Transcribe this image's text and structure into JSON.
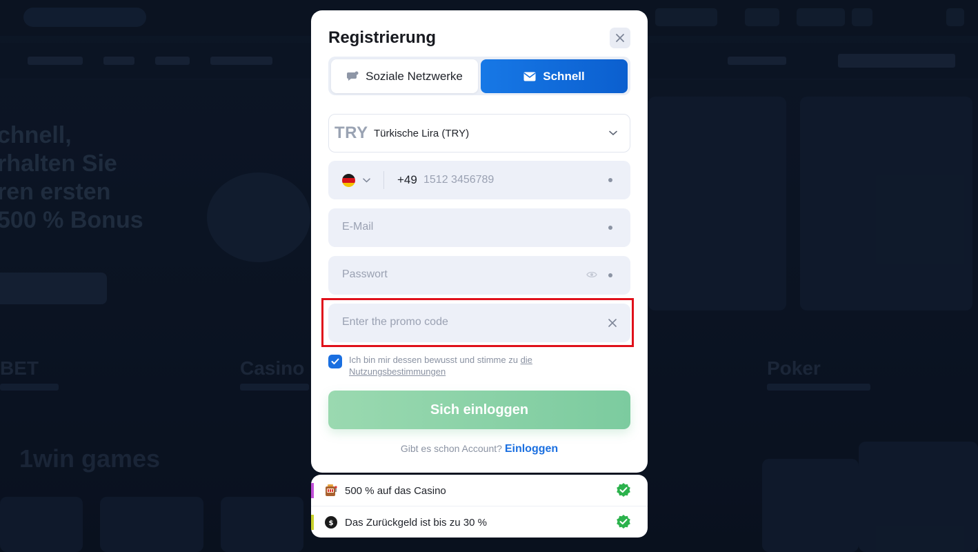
{
  "modal": {
    "title": "Registrierung",
    "tabs": [
      {
        "label": "Soziale Netzwerke",
        "icon": "chat-bubble-icon",
        "active": false
      },
      {
        "label": "Schnell",
        "icon": "envelope-icon",
        "active": true
      }
    ],
    "currency": {
      "code": "TRY",
      "name": "Türkische Lira (TRY)"
    },
    "phone": {
      "country_flag": "de-flag",
      "dial_code": "+49",
      "placeholder": "1512 3456789"
    },
    "email": {
      "placeholder": "E-Mail"
    },
    "password": {
      "placeholder": "Passwort"
    },
    "promo": {
      "placeholder": "Enter the promo code"
    },
    "consent": {
      "checked": true,
      "text": "Ich bin mir dessen bewusst und stimme zu",
      "link": "die Nutzungsbestimmungen"
    },
    "submit_label": "Sich einloggen",
    "login_prompt": "Gibt es schon Account?",
    "login_link": "Einloggen"
  },
  "bonus": [
    {
      "text": "500 % auf das Casino",
      "icon": "slot-machine-icon",
      "accent": "#c04fd8"
    },
    {
      "text": "Das Zurückgeld ist bis zu 30 %",
      "icon": "cashback-icon",
      "accent": "#c9d22b"
    }
  ],
  "colors": {
    "accent_blue": "#1778e6",
    "submit_green": "#8fd4aa",
    "highlight_red": "#e0101a",
    "check_green": "#2bb24c"
  },
  "background": {
    "hero_text": [
      "chnell,",
      "rhalten Sie",
      "ren ersten",
      "500 % Bonus"
    ],
    "categories": [
      "BET",
      "Casino",
      "Poker"
    ],
    "section_title": "1win games"
  }
}
